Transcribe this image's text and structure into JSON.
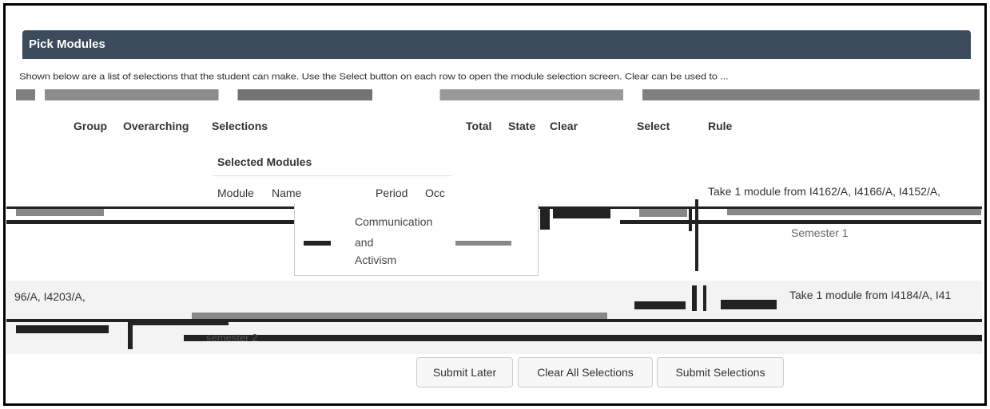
{
  "panel": {
    "title": "Pick Modules"
  },
  "description": {
    "line1": "Shown below are a list of selections that the student can make. Use the Select button on each row to open the module selection screen. Clear can be used to ..."
  },
  "table": {
    "headers": [
      "Group",
      "Overarching",
      "Selections",
      "Total",
      "State",
      "Clear",
      "Select",
      "Rule"
    ]
  },
  "selected_modules": {
    "title": "Selected Modules",
    "columns": [
      "Module",
      "Name",
      "Period",
      "Occ"
    ]
  },
  "rows": [
    {
      "rule": "Take 1 module from I4162/A, I4166/A, I4152/A,",
      "inner_items": [
        "Communication",
        "and",
        "Activism"
      ],
      "semester": "Semester 1"
    },
    {
      "codes": "96/A, I4203/A,",
      "rule": "Take 1 module from I4184/A, I41",
      "semester": "semester 2"
    }
  ],
  "buttons": {
    "submit_later": "Submit Later",
    "clear_all": "Clear All Selections",
    "submit_selections": "Submit Selections"
  },
  "colors": {
    "header_bg": "#3b4b5c",
    "row_alt_bg": "#f3f3f3",
    "button_bg": "#f7f7f7"
  }
}
